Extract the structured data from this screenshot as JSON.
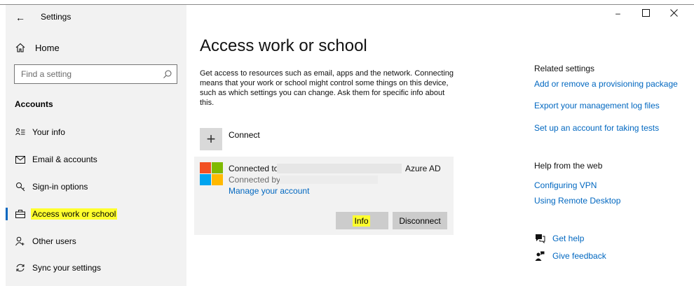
{
  "window": {
    "title": "Settings",
    "back_glyph": "←",
    "minimize_glyph": "–",
    "maximize_glyph": "☐",
    "close_glyph": "✕"
  },
  "sidebar": {
    "home_label": "Home",
    "search_placeholder": "Find a setting",
    "section_title": "Accounts",
    "items": [
      {
        "label": "Your info",
        "icon": "person-card-icon",
        "selected": false
      },
      {
        "label": "Email & accounts",
        "icon": "mail-icon",
        "selected": false
      },
      {
        "label": "Sign-in options",
        "icon": "key-icon",
        "selected": false
      },
      {
        "label": "Access work or school",
        "icon": "briefcase-icon",
        "selected": true
      },
      {
        "label": "Other users",
        "icon": "add-person-icon",
        "selected": false
      },
      {
        "label": "Sync your settings",
        "icon": "sync-icon",
        "selected": false
      }
    ]
  },
  "main": {
    "title": "Access work or school",
    "description": "Get access to resources such as email, apps and the network. Connecting means that your work or school might control some things on this device, such as which settings you can change. Ask them for specific info about this.",
    "connect_label": "Connect",
    "account": {
      "connected_to": "Connected to",
      "azure": "Azure AD",
      "connected_by": "Connected by",
      "manage_link": "Manage your account",
      "info_button": "Info",
      "disconnect_button": "Disconnect"
    }
  },
  "related": {
    "heading": "Related settings",
    "links": [
      "Add or remove a provisioning package",
      "Export your management log files",
      "Set up an account for taking tests"
    ],
    "help_heading": "Help from the web",
    "help_links": [
      "Configuring VPN",
      "Using Remote Desktop"
    ],
    "get_help": "Get help",
    "give_feedback": "Give feedback"
  },
  "colors": {
    "accent": "#0067c0",
    "highlight": "#ffff2e",
    "sidebar_bg": "#f2f2f2",
    "ms_red": "#f25022",
    "ms_green": "#7fba00",
    "ms_blue": "#00a4ef",
    "ms_yellow": "#ffb900"
  }
}
